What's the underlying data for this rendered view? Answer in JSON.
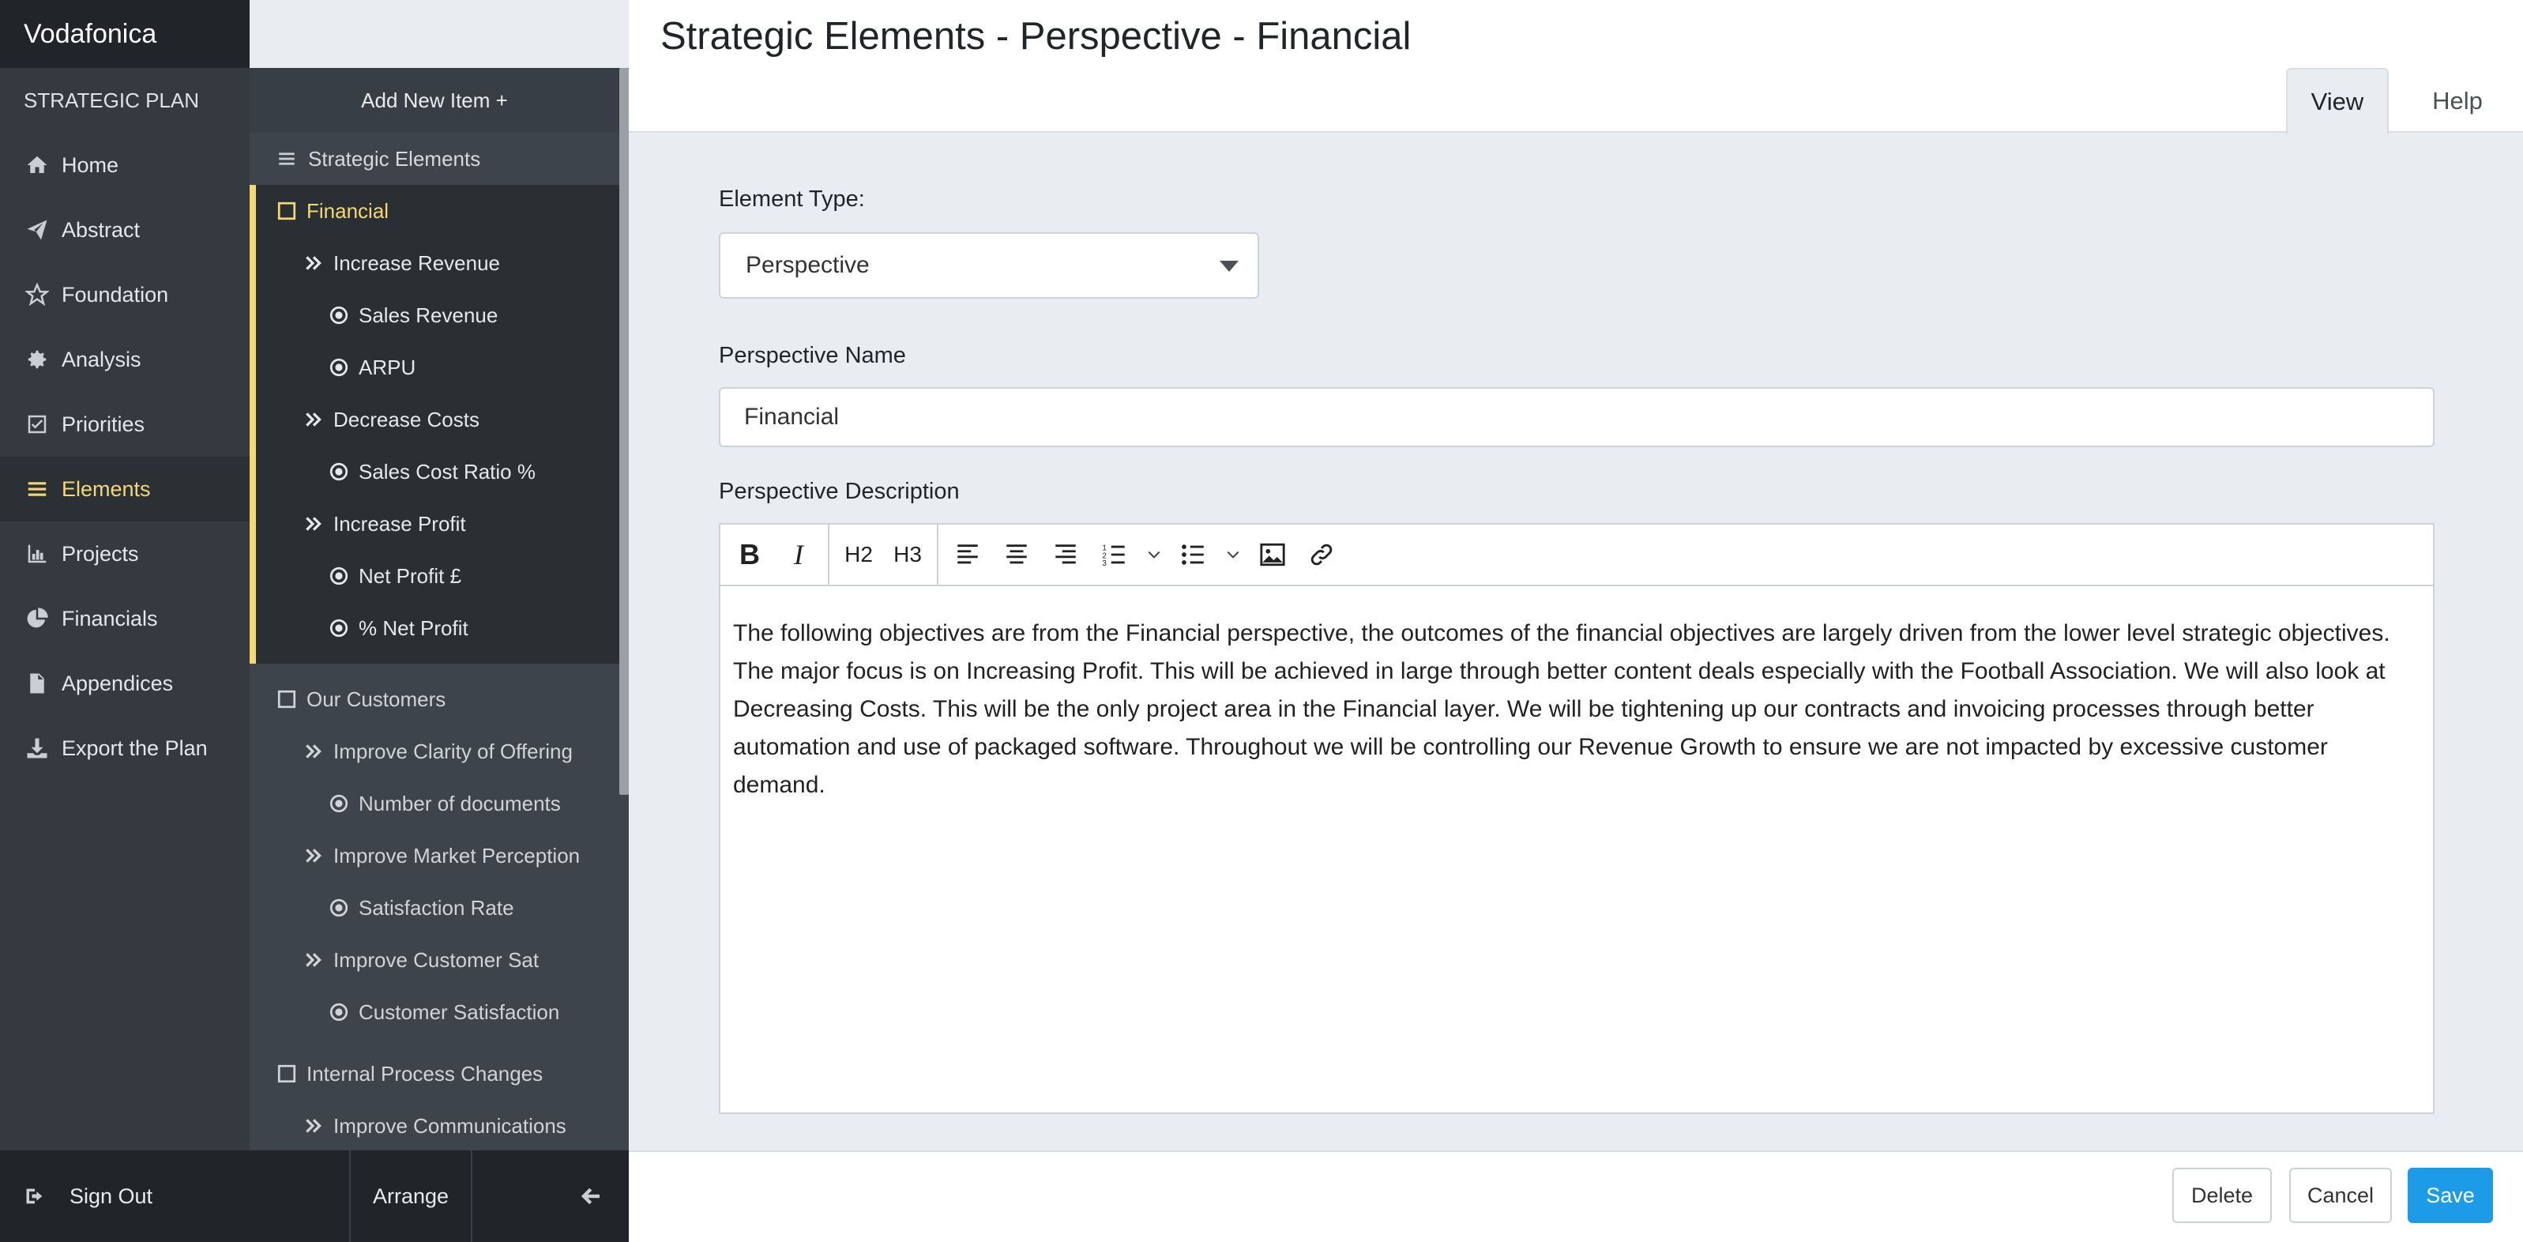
{
  "app": {
    "brand": "Vodafonica",
    "section_label": "STRATEGIC PLAN"
  },
  "nav": {
    "items": [
      {
        "label": "Home",
        "icon": "home-icon"
      },
      {
        "label": "Abstract",
        "icon": "paper-plane-icon"
      },
      {
        "label": "Foundation",
        "icon": "star-icon"
      },
      {
        "label": "Analysis",
        "icon": "gear-icon"
      },
      {
        "label": "Priorities",
        "icon": "checkbox-icon"
      },
      {
        "label": "Elements",
        "icon": "list-icon",
        "active": true
      },
      {
        "label": "Projects",
        "icon": "bar-chart-icon"
      },
      {
        "label": "Financials",
        "icon": "pie-chart-icon"
      },
      {
        "label": "Appendices",
        "icon": "document-icon"
      },
      {
        "label": "Export the Plan",
        "icon": "download-icon"
      }
    ]
  },
  "tree": {
    "add_new": "Add New Item +",
    "header": "Strategic Elements",
    "groups": [
      {
        "title": "Financial",
        "selected": true,
        "children": [
          {
            "label": "Increase Revenue",
            "kind": "objective"
          },
          {
            "label": "Sales Revenue",
            "kind": "measure"
          },
          {
            "label": "ARPU",
            "kind": "measure"
          },
          {
            "label": "Decrease Costs",
            "kind": "objective"
          },
          {
            "label": "Sales Cost Ratio %",
            "kind": "measure"
          },
          {
            "label": "Increase Profit",
            "kind": "objective"
          },
          {
            "label": "Net Profit £",
            "kind": "measure"
          },
          {
            "label": "% Net Profit",
            "kind": "measure"
          }
        ]
      },
      {
        "title": "Our Customers",
        "selected": false,
        "children": [
          {
            "label": "Improve Clarity of Offering",
            "kind": "objective"
          },
          {
            "label": "Number of documents",
            "kind": "measure"
          },
          {
            "label": "Improve Market Perception",
            "kind": "objective"
          },
          {
            "label": "Satisfaction Rate",
            "kind": "measure"
          },
          {
            "label": "Improve Customer Sat",
            "kind": "objective"
          },
          {
            "label": "Customer Satisfaction",
            "kind": "measure"
          }
        ]
      },
      {
        "title": "Internal Process Changes",
        "selected": false,
        "children": [
          {
            "label": "Improve Communications",
            "kind": "objective"
          }
        ]
      }
    ]
  },
  "bottom": {
    "signout": "Sign Out",
    "arrange": "Arrange"
  },
  "header": {
    "title": "Strategic Elements - Perspective - Financial",
    "tabs": {
      "view": "View",
      "help": "Help"
    }
  },
  "form": {
    "element_type_label": "Element Type:",
    "element_type_value": "Perspective",
    "name_label": "Perspective Name",
    "name_value": "Financial",
    "description_label": "Perspective Description",
    "toolbar": {
      "h2": "H2",
      "h3": "H3"
    },
    "description": "The following objectives are from the Financial perspective, the outcomes of the financial objectives are largely driven from the lower level strategic objectives. The major focus is on Increasing Profit. This will be achieved in large through better content deals especially with the Football Association. We will also look at Decreasing Costs. This will be the only project area in the Financial layer. We will be tightening up our contracts and invoicing processes through better automation and use of packaged software. Throughout we will be controlling our Revenue Growth to ensure we are not impacted by excessive customer demand."
  },
  "footer": {
    "delete": "Delete",
    "cancel": "Cancel",
    "save": "Save"
  },
  "colors": {
    "accent": "#f5d873",
    "primary": "#1e9be6",
    "nav_bg": "#343a40",
    "brand_bg": "#212529"
  }
}
